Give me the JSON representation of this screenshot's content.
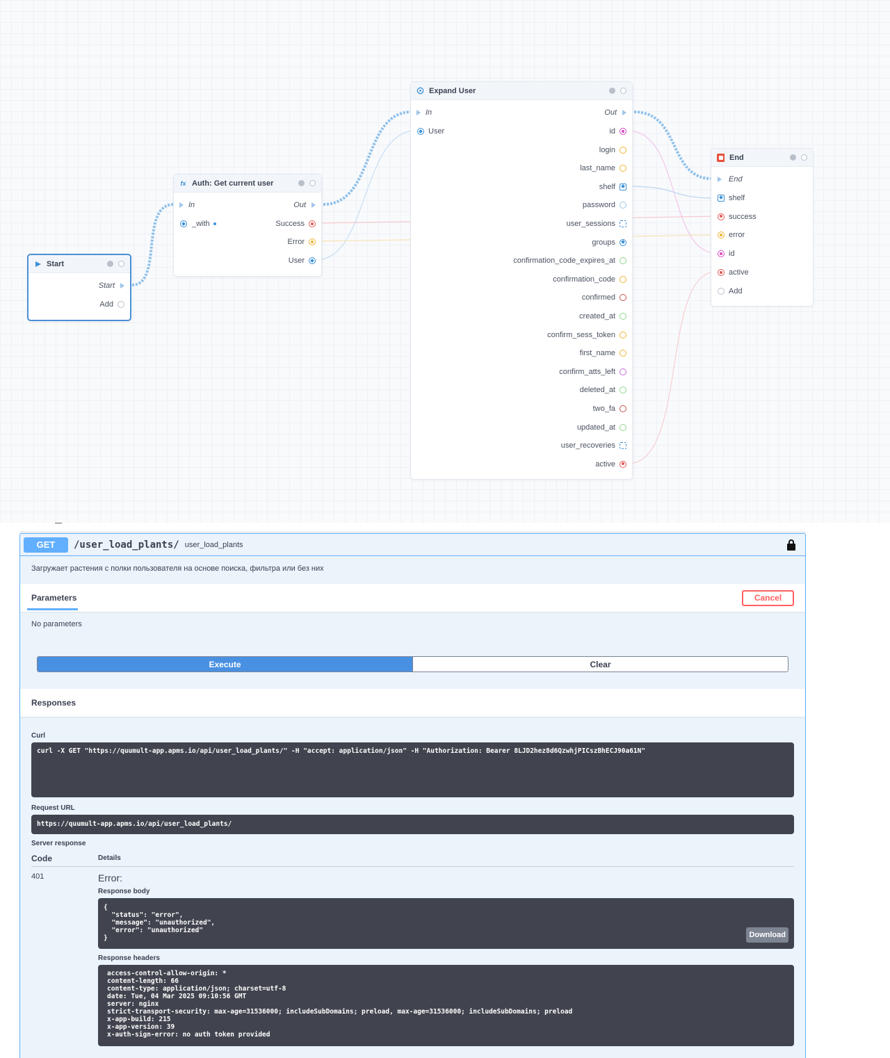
{
  "colors": {
    "accent": "#61affe",
    "execute": "#4990e2",
    "cancel": "#ff6060",
    "wire_flow": "#8ec0ea",
    "pin_red": "#e05a55",
    "pin_orange": "#f0b330",
    "pin_magenta": "#d946c2",
    "pin_blue": "#3b8fd6",
    "pin_green": "#8ed88e",
    "pin_lightblue": "#9cc8ea",
    "pin_darkred": "#c85050",
    "pin_violet": "#c36ad8"
  },
  "flow": {
    "start_node": {
      "title": "Start",
      "outputs": {
        "start": "Start",
        "add": "Add"
      }
    },
    "auth_node": {
      "title": "Auth: Get current user",
      "inputs": {
        "in": "In",
        "with": "_with"
      },
      "outputs": {
        "out": "Out",
        "success": "Success",
        "error": "Error",
        "user": "User"
      }
    },
    "expand_node": {
      "title": "Expand User",
      "inputs": {
        "in": "In",
        "user": "User"
      },
      "out_label": "Out",
      "fields": [
        "id",
        "login",
        "last_name",
        "shelf",
        "password",
        "user_sessions",
        "groups",
        "confirmation_code_expires_at",
        "confirmation_code",
        "confirmed",
        "created_at",
        "confirm_sess_token",
        "first_name",
        "confirm_atts_left",
        "deleted_at",
        "two_fa",
        "updated_at",
        "user_recoveries",
        "active"
      ]
    },
    "end_node": {
      "title": "End",
      "inputs": [
        "End",
        "shelf",
        "success",
        "error",
        "id",
        "active",
        "Add"
      ]
    }
  },
  "swagger": {
    "method": "GET",
    "path": "/user_load_plants/",
    "operation_id": "user_load_plants",
    "description": "Загружает растения с полки пользователя на основе поиска, фильтра или без них",
    "parameters_title": "Parameters",
    "cancel_label": "Cancel",
    "no_parameters": "No parameters",
    "execute_label": "Execute",
    "clear_label": "Clear",
    "responses_title": "Responses",
    "curl_label": "Curl",
    "curl": "curl -X GET \"https://quumult-app.apms.io/api/user_load_plants/\" -H \"accept: application/json\" -H \"Authorization: Bearer 8LJD2hez8d6QzwhjPICszBhECJ90a61N\"",
    "request_url_label": "Request URL",
    "request_url": "https://quumult-app.apms.io/api/user_load_plants/",
    "server_response_label": "Server response",
    "code_header": "Code",
    "details_header": "Details",
    "code": "401",
    "error_title": "Error:",
    "response_body_label": "Response body",
    "response_body": "{\n  \"status\": \"error\",\n  \"message\": \"unauthorized\",\n  \"error\": \"unauthorized\"\n}",
    "download_label": "Download",
    "response_headers_label": "Response headers",
    "response_headers": "access-control-allow-origin: *\ncontent-length: 66\ncontent-type: application/json; charset=utf-8\ndate: Tue, 04 Mar 2025 09:10:56 GMT\nserver: nginx\nstrict-transport-security: max-age=31536000; includeSubDomains; preload, max-age=31536000; includeSubDomains; preload\nx-app-build: 215\nx-app-version: 39\nx-auth-sign-error: no auth token provided"
  }
}
